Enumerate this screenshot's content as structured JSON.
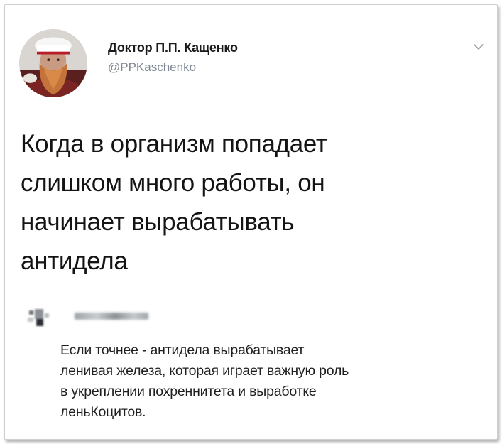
{
  "tweet": {
    "author": {
      "display_name": "Доктор П.П. Кащенко",
      "handle": "@PPKaschenko",
      "avatar_icon": "bearded-man-chef-hat-avatar"
    },
    "menu_icon": "chevron-down-icon",
    "text_lines": [
      "Когда в организм попадает",
      "слишком много работы, он",
      "начинает вырабатывать",
      "антидела"
    ]
  },
  "reply": {
    "author_name": "",
    "avatar_icon": "blurred-avatar-icon",
    "text_lines": [
      "Если точнее - антидела вырабатывает",
      "ленивая железа, которая играет важную роль",
      "в укреплении похреннитета и выработке",
      "леньКоцитов."
    ]
  },
  "colors": {
    "handle": "#7d8791",
    "text": "#141414",
    "divider": "#cfcfcf",
    "background": "#ffffff"
  }
}
